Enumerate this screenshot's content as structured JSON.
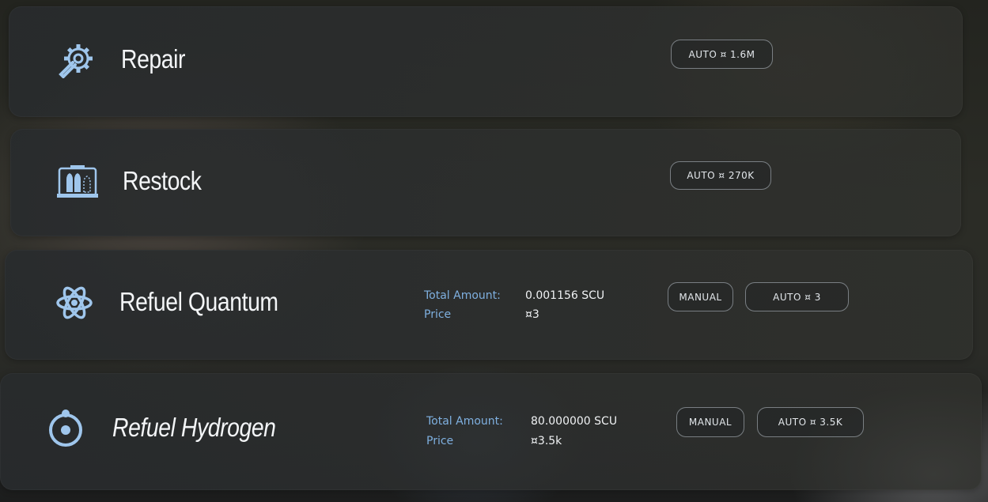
{
  "services": {
    "repair": {
      "title": "Repair",
      "icon": "wrench-gear-icon",
      "auto_button": "AUTO ¤ 1.6M"
    },
    "restock": {
      "title": "Restock",
      "icon": "ammo-crate-icon",
      "auto_button": "AUTO ¤ 270K"
    },
    "refuel_quantum": {
      "title": "Refuel Quantum",
      "icon": "atom-icon",
      "total_amount_label": "Total Amount:",
      "total_amount_value": "0.001156 SCU",
      "price_label": "Price",
      "price_value": "¤3",
      "manual_button": "MANUAL",
      "auto_button": "AUTO ¤ 3"
    },
    "refuel_hydrogen": {
      "title": "Refuel Hydrogen",
      "icon": "hydrogen-orbit-icon",
      "total_amount_label": "Total Amount:",
      "total_amount_value": "80.000000 SCU",
      "price_label": "Price",
      "price_value": "¤3.5k",
      "manual_button": "MANUAL",
      "auto_button": "AUTO ¤ 3.5K"
    }
  },
  "colors": {
    "accent_blue": "#9fc6ec",
    "label_blue": "#7fb0e0",
    "title_white": "#f3f5f7"
  }
}
